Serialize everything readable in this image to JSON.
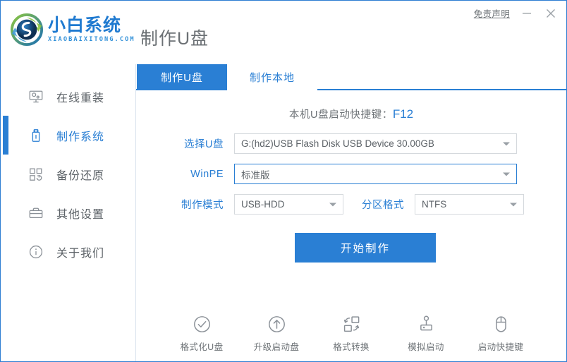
{
  "window": {
    "title": "制作U盘",
    "disclaimer_label": "免责声明",
    "minimize_label": "−",
    "close_label": "×"
  },
  "brand": {
    "name_cn": "小白系统",
    "name_en": "XIAOBAIXITONG.COM",
    "logo_icon": "recycle-arrows-logo"
  },
  "sidebar": {
    "items": [
      {
        "label": "在线重装",
        "icon": "monitor-icon",
        "active": false
      },
      {
        "label": "制作系统",
        "icon": "usb-drive-icon",
        "active": true
      },
      {
        "label": "备份还原",
        "icon": "grid-squares-icon",
        "active": false
      },
      {
        "label": "其他设置",
        "icon": "briefcase-icon",
        "active": false
      },
      {
        "label": "关于我们",
        "icon": "info-circle-icon",
        "active": false
      }
    ]
  },
  "main": {
    "tabs": [
      {
        "label": "制作U盘",
        "active": true
      },
      {
        "label": "制作本地",
        "active": false
      }
    ],
    "shortcut_text": "本机U盘启动快捷键：",
    "shortcut_key": "F12",
    "fields": {
      "usb_label": "选择U盘",
      "usb_value": "G:(hd2)USB Flash Disk USB Device 30.00GB",
      "winpe_label": "WinPE",
      "winpe_value": "标准版",
      "mode_label": "制作模式",
      "mode_value": "USB-HDD",
      "partition_label": "分区格式",
      "partition_value": "NTFS"
    },
    "submit_label": "开始制作"
  },
  "toolbar": {
    "items": [
      {
        "label": "格式化U盘",
        "icon": "check-circle-icon"
      },
      {
        "label": "升级启动盘",
        "icon": "arrow-up-circle-icon"
      },
      {
        "label": "格式转换",
        "icon": "convert-shapes-icon"
      },
      {
        "label": "模拟启动",
        "icon": "joystick-icon"
      },
      {
        "label": "启动快捷键",
        "icon": "mouse-icon"
      }
    ]
  },
  "colors": {
    "accent": "#2a7fd4",
    "text": "#6e7377",
    "border": "#d5d9dd"
  }
}
